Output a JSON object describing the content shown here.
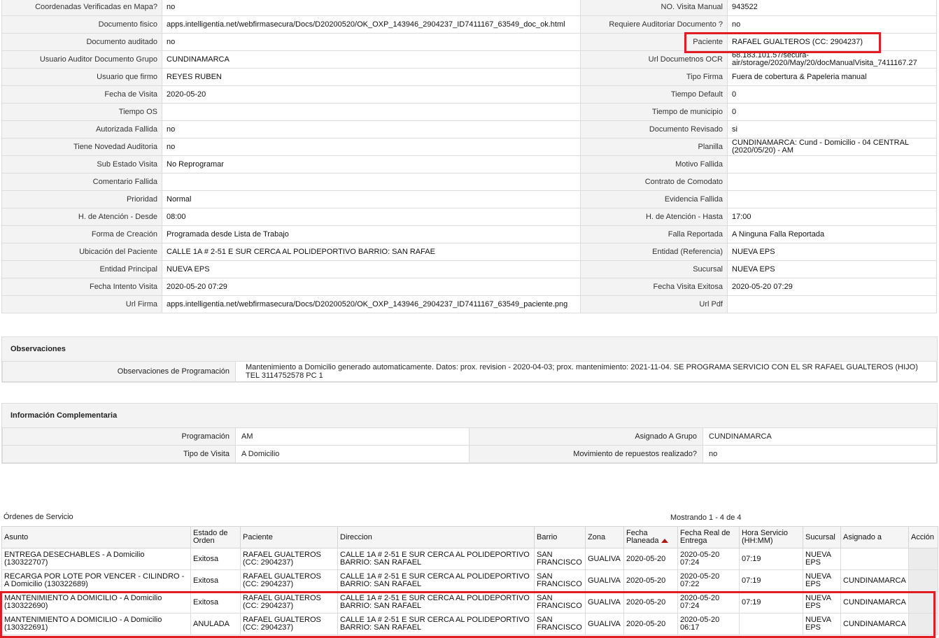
{
  "details": [
    [
      "Coordenadas Verificadas en Mapa?",
      "no",
      "NO. Visita Manual",
      "943522"
    ],
    [
      "Documento fisico",
      "apps.intelligentia.net/webfirmasecura/Docs/D20200520/OK_OXP_143946_2904237_ID7411167_63549_doc_ok.html",
      "Requiere Auditoriar Documento ?",
      "no"
    ],
    [
      "Documento auditado",
      "no",
      "Paciente",
      "RAFAEL GUALTEROS (CC: 2904237)"
    ],
    [
      "Usuario Auditor Documento Grupo",
      "CUNDINAMARCA",
      "Url Documetnos OCR",
      "68.183.101.57/secura-air/storage/2020/May/20/docManualVisita_7411167.27"
    ],
    [
      "Usuario que firmo",
      "REYES RUBEN",
      "Tipo Firma",
      "Fuera de cobertura & Papeleria manual"
    ],
    [
      "Fecha de Visita",
      "2020-05-20",
      "Tiempo Default",
      "0"
    ],
    [
      "Tiempo OS",
      "",
      "Tiempo de municipio",
      "0"
    ],
    [
      "Autorizada Fallida",
      "no",
      "Documento Revisado",
      "si"
    ],
    [
      "Tiene Novedad Auditoria",
      "no",
      "Planilla",
      "CUNDINAMARCA: Cund - Domicilio - 04 CENTRAL (2020/05/20) - AM"
    ],
    [
      "Sub Estado Visita",
      "No Reprogramar",
      "Motivo Fallida",
      ""
    ],
    [
      "Comentario Fallida",
      "",
      "Contrato de Comodato",
      ""
    ],
    [
      "Prioridad",
      "Normal",
      "Evidencia Fallida",
      ""
    ],
    [
      "H. de Atención - Desde",
      "08:00",
      "H. de Atención - Hasta",
      "17:00"
    ],
    [
      "Forma de Creación",
      "Programada desde Lista de Trabajo",
      "Falla Reportada",
      "A Ninguna Falla Reportada"
    ],
    [
      "Ubicación del Paciente",
      "CALLE 1A # 2-51 E SUR CERCA AL POLIDEPORTIVO BARRIO: SAN RAFAE",
      "Entidad (Referencia)",
      "NUEVA EPS"
    ],
    [
      "Entidad Principal",
      "NUEVA EPS",
      "Sucursal",
      "NUEVA EPS"
    ],
    [
      "Fecha Intento Visita",
      "2020-05-20 07:29",
      "Fecha Visita Exitosa",
      "2020-05-20 07:29"
    ],
    [
      "Url Firma",
      "apps.intelligentia.net/webfirmasecura/Docs/D20200520/OK_OXP_143946_2904237_ID7411167_63549_paciente.png",
      "Url Pdf",
      ""
    ]
  ],
  "observaciones": {
    "title": "Observaciones",
    "label": "Observaciones de Programación",
    "text": "Mantenimiento a Domicilio generado automaticamente. Datos: prox. revision - 2020-04-03; prox. mantenimiento: 2021-11-04. SE PROGRAMA SERVICIO CON EL SR RAFAEL GUALTEROS (HIJO) TEL 3114752578 PC 1"
  },
  "complementaria": {
    "title": "Información Complementaria",
    "rows": [
      [
        "Programación",
        "AM",
        "Asignado A Grupo",
        "CUNDINAMARCA"
      ],
      [
        "Tipo de Visita",
        "A Domicilio",
        "Movimiento de repuestos realizado?",
        "no"
      ]
    ]
  },
  "orders": {
    "title": "Órdenes de Servicio",
    "count": "Mostrando 1 - 4 de 4",
    "headers": [
      "Asunto",
      "Estado de Orden",
      "Paciente",
      "Direccion",
      "Barrio",
      "Zona",
      "Fecha Planeada",
      "Fecha Real de Entrega",
      "Hora Servicio (HH:MM)",
      "Sucursal",
      "Asignado a",
      "Acción"
    ],
    "sort_column": "Fecha Planeada",
    "rows": [
      [
        "ENTREGA DESECHABLES - A Domicilio (130322707)",
        "Exitosa",
        "RAFAEL GUALTEROS (CC: 2904237)",
        "CALLE 1A # 2-51 E SUR CERCA AL POLIDEPORTIVO BARRIO: SAN RAFAEL",
        "SAN FRANCISCO",
        "GUALIVA",
        "2020-05-20",
        "2020-05-20 07:24",
        "07:19",
        "NUEVA EPS",
        "",
        ""
      ],
      [
        "RECARGA POR LOTE POR VENCER - CILINDRO - A Domicilio (130322689)",
        "Exitosa",
        "RAFAEL GUALTEROS (CC: 2904237)",
        "CALLE 1A # 2-51 E SUR CERCA AL POLIDEPORTIVO BARRIO: SAN RAFAEL",
        "SAN FRANCISCO",
        "GUALIVA",
        "2020-05-20",
        "2020-05-20 07:22",
        "07:19",
        "NUEVA EPS",
        "CUNDINAMARCA",
        ""
      ],
      [
        "MANTENIMIENTO A DOMICILIO - A Domicilio (130322690)",
        "Exitosa",
        "RAFAEL GUALTEROS (CC: 2904237)",
        "CALLE 1A # 2-51 E SUR CERCA AL POLIDEPORTIVO BARRIO: SAN RAFAEL",
        "SAN FRANCISCO",
        "GUALIVA",
        "2020-05-20",
        "2020-05-20 07:24",
        "07:19",
        "NUEVA EPS",
        "CUNDINAMARCA",
        ""
      ],
      [
        "MANTENIMIENTO A DOMICILIO - A Domicilio (130322691)",
        "ANULADA",
        "RAFAEL GUALTEROS (CC: 2904237)",
        "CALLE 1A # 2-51 E SUR CERCA AL POLIDEPORTIVO BARRIO: SAN RAFAEL",
        "SAN FRANCISCO",
        "GUALIVA",
        "2020-05-20",
        "2020-05-20 06:17",
        "",
        "NUEVA EPS",
        "CUNDINAMARCA",
        ""
      ]
    ]
  },
  "colors": {
    "highlight": "#e31b23",
    "label_bg": "#f3f3f3",
    "border": "#dcdcdc"
  }
}
